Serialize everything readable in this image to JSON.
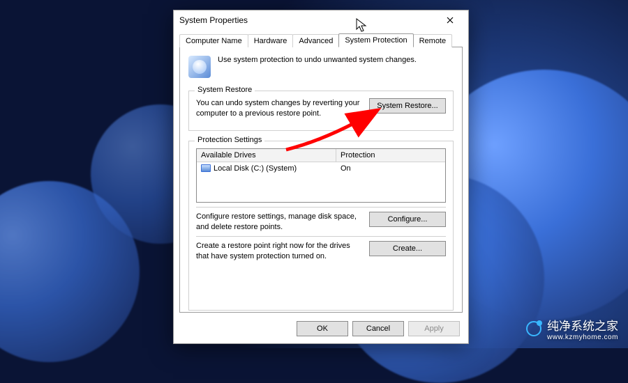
{
  "window": {
    "title": "System Properties"
  },
  "tabs": [
    {
      "label": "Computer Name"
    },
    {
      "label": "Hardware"
    },
    {
      "label": "Advanced"
    },
    {
      "label": "System Protection"
    },
    {
      "label": "Remote"
    }
  ],
  "active_tab_index": 3,
  "intro": {
    "text": "Use system protection to undo unwanted system changes."
  },
  "restore": {
    "frame_title": "System Restore",
    "text": "You can undo system changes by reverting your computer to a previous restore point.",
    "button": "System Restore..."
  },
  "settings": {
    "frame_title": "Protection Settings",
    "columns": {
      "drives": "Available Drives",
      "protection": "Protection"
    },
    "rows": [
      {
        "drive": "Local Disk (C:) (System)",
        "protection": "On"
      }
    ],
    "configure_text": "Configure restore settings, manage disk space, and delete restore points.",
    "configure_button": "Configure...",
    "create_text": "Create a restore point right now for the drives that have system protection turned on.",
    "create_button": "Create..."
  },
  "footer": {
    "ok": "OK",
    "cancel": "Cancel",
    "apply": "Apply"
  },
  "watermark": {
    "brand": "纯净系统之家",
    "url": "www.kzmyhome.com"
  }
}
